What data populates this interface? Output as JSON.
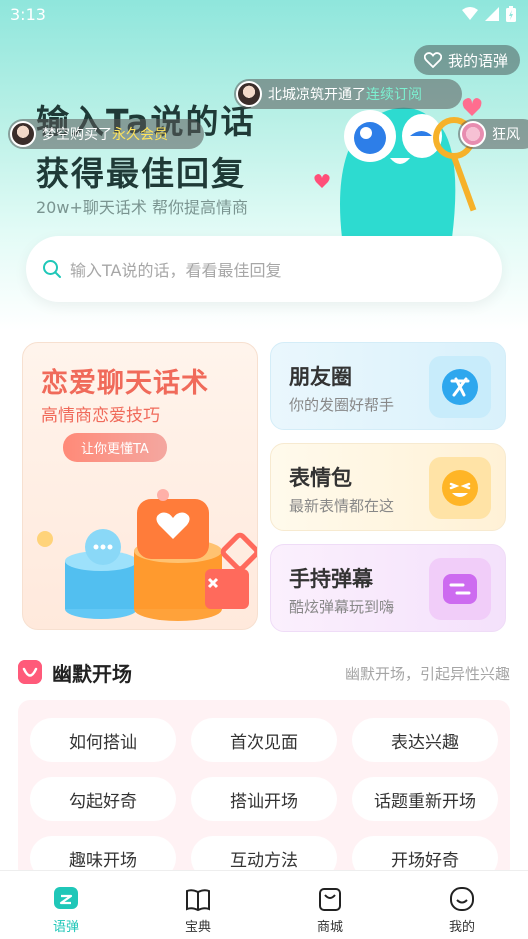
{
  "status": {
    "time": "3:13"
  },
  "hero": {
    "title_line1": "输入Ta说的话",
    "title_line2": "获得最佳回复",
    "subtitle": "20w+聊天话术 帮你提高情商",
    "my_danmu_label": "我的语弹"
  },
  "ticker": [
    {
      "prefix": "北城凉筑开通了",
      "highlight": "连续订阅"
    },
    {
      "prefix": "梦空购买了",
      "highlight": "永久会员"
    },
    {
      "prefix": "狂风",
      "highlight": ""
    }
  ],
  "search": {
    "placeholder": "输入TA说的话，看看最佳回复"
  },
  "features": {
    "big": {
      "title": "恋爱聊天话术",
      "subtitle": "高情商恋爱技巧",
      "tag": "让你更懂TA"
    },
    "moments": {
      "title": "朋友圈",
      "subtitle": "你的发圈好帮手"
    },
    "stickers": {
      "title": "表情包",
      "subtitle": "最新表情都在这"
    },
    "danmu": {
      "title": "手持弹幕",
      "subtitle": "酷炫弹幕玩到嗨"
    }
  },
  "section": {
    "title": "幽默开场",
    "subtitle": "幽默开场，引起异性兴趣",
    "chips": [
      "如何搭讪",
      "首次见面",
      "表达兴趣",
      "勾起好奇",
      "搭讪开场",
      "话题重新开场",
      "趣味开场",
      "互动方法",
      "开场好奇"
    ]
  },
  "tabs": [
    {
      "label": "语弹",
      "icon": "chat-bubble-icon",
      "active": true
    },
    {
      "label": "宝典",
      "icon": "book-icon",
      "active": false
    },
    {
      "label": "商城",
      "icon": "shopping-bag-icon",
      "active": false
    },
    {
      "label": "我的",
      "icon": "smiley-icon",
      "active": false
    }
  ],
  "colors": {
    "accent": "#1fc7b8",
    "big_card_text": "#f06a5a",
    "chip_panel": "#fff2f4"
  }
}
